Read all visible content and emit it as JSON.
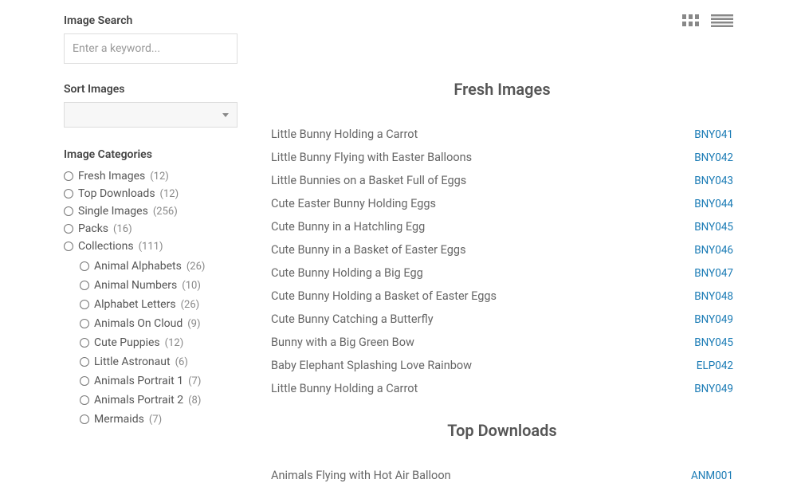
{
  "search": {
    "label": "Image Search",
    "placeholder": "Enter a keyword..."
  },
  "sort": {
    "label": "Sort Images"
  },
  "categories": {
    "label": "Image Categories",
    "items": [
      {
        "name": "Fresh Images",
        "count": "(12)"
      },
      {
        "name": "Top Downloads",
        "count": "(12)"
      },
      {
        "name": "Single Images",
        "count": "(256)"
      },
      {
        "name": "Packs",
        "count": "(16)"
      },
      {
        "name": "Collections",
        "count": "(111)"
      }
    ],
    "subitems": [
      {
        "name": "Animal Alphabets",
        "count": "(26)"
      },
      {
        "name": "Animal Numbers",
        "count": "(10)"
      },
      {
        "name": "Alphabet Letters",
        "count": "(26)"
      },
      {
        "name": "Animals On Cloud",
        "count": "(9)"
      },
      {
        "name": "Cute Puppies",
        "count": "(12)"
      },
      {
        "name": "Little Astronaut",
        "count": "(6)"
      },
      {
        "name": "Animals Portrait 1",
        "count": "(7)"
      },
      {
        "name": "Animals Portrait 2",
        "count": "(8)"
      },
      {
        "name": "Mermaids",
        "count": "(7)"
      }
    ]
  },
  "sections": {
    "fresh": {
      "title": "Fresh Images",
      "rows": [
        {
          "title": "Little Bunny Holding a Carrot",
          "code": "BNY041"
        },
        {
          "title": "Little Bunny Flying with Easter Balloons",
          "code": "BNY042"
        },
        {
          "title": "Little Bunnies on a Basket Full of Eggs",
          "code": "BNY043"
        },
        {
          "title": "Cute Easter Bunny Holding Eggs",
          "code": "BNY044"
        },
        {
          "title": "Cute Bunny in a Hatchling Egg",
          "code": "BNY045"
        },
        {
          "title": "Cute Bunny in a Basket of Easter Eggs",
          "code": "BNY046"
        },
        {
          "title": "Cute Bunny Holding a Big Egg",
          "code": "BNY047"
        },
        {
          "title": "Cute Bunny Holding a Basket of Easter Eggs",
          "code": "BNY048"
        },
        {
          "title": "Cute Bunny Catching a Butterfly",
          "code": "BNY049"
        },
        {
          "title": "Bunny with a Big Green Bow",
          "code": "BNY045"
        },
        {
          "title": "Baby Elephant Splashing Love Rainbow",
          "code": "ELP042"
        },
        {
          "title": "Little Bunny Holding a Carrot",
          "code": "BNY049"
        }
      ]
    },
    "top": {
      "title": "Top Downloads",
      "rows": [
        {
          "title": "Animals Flying with Hot Air Balloon",
          "code": "ANM001"
        }
      ]
    }
  }
}
